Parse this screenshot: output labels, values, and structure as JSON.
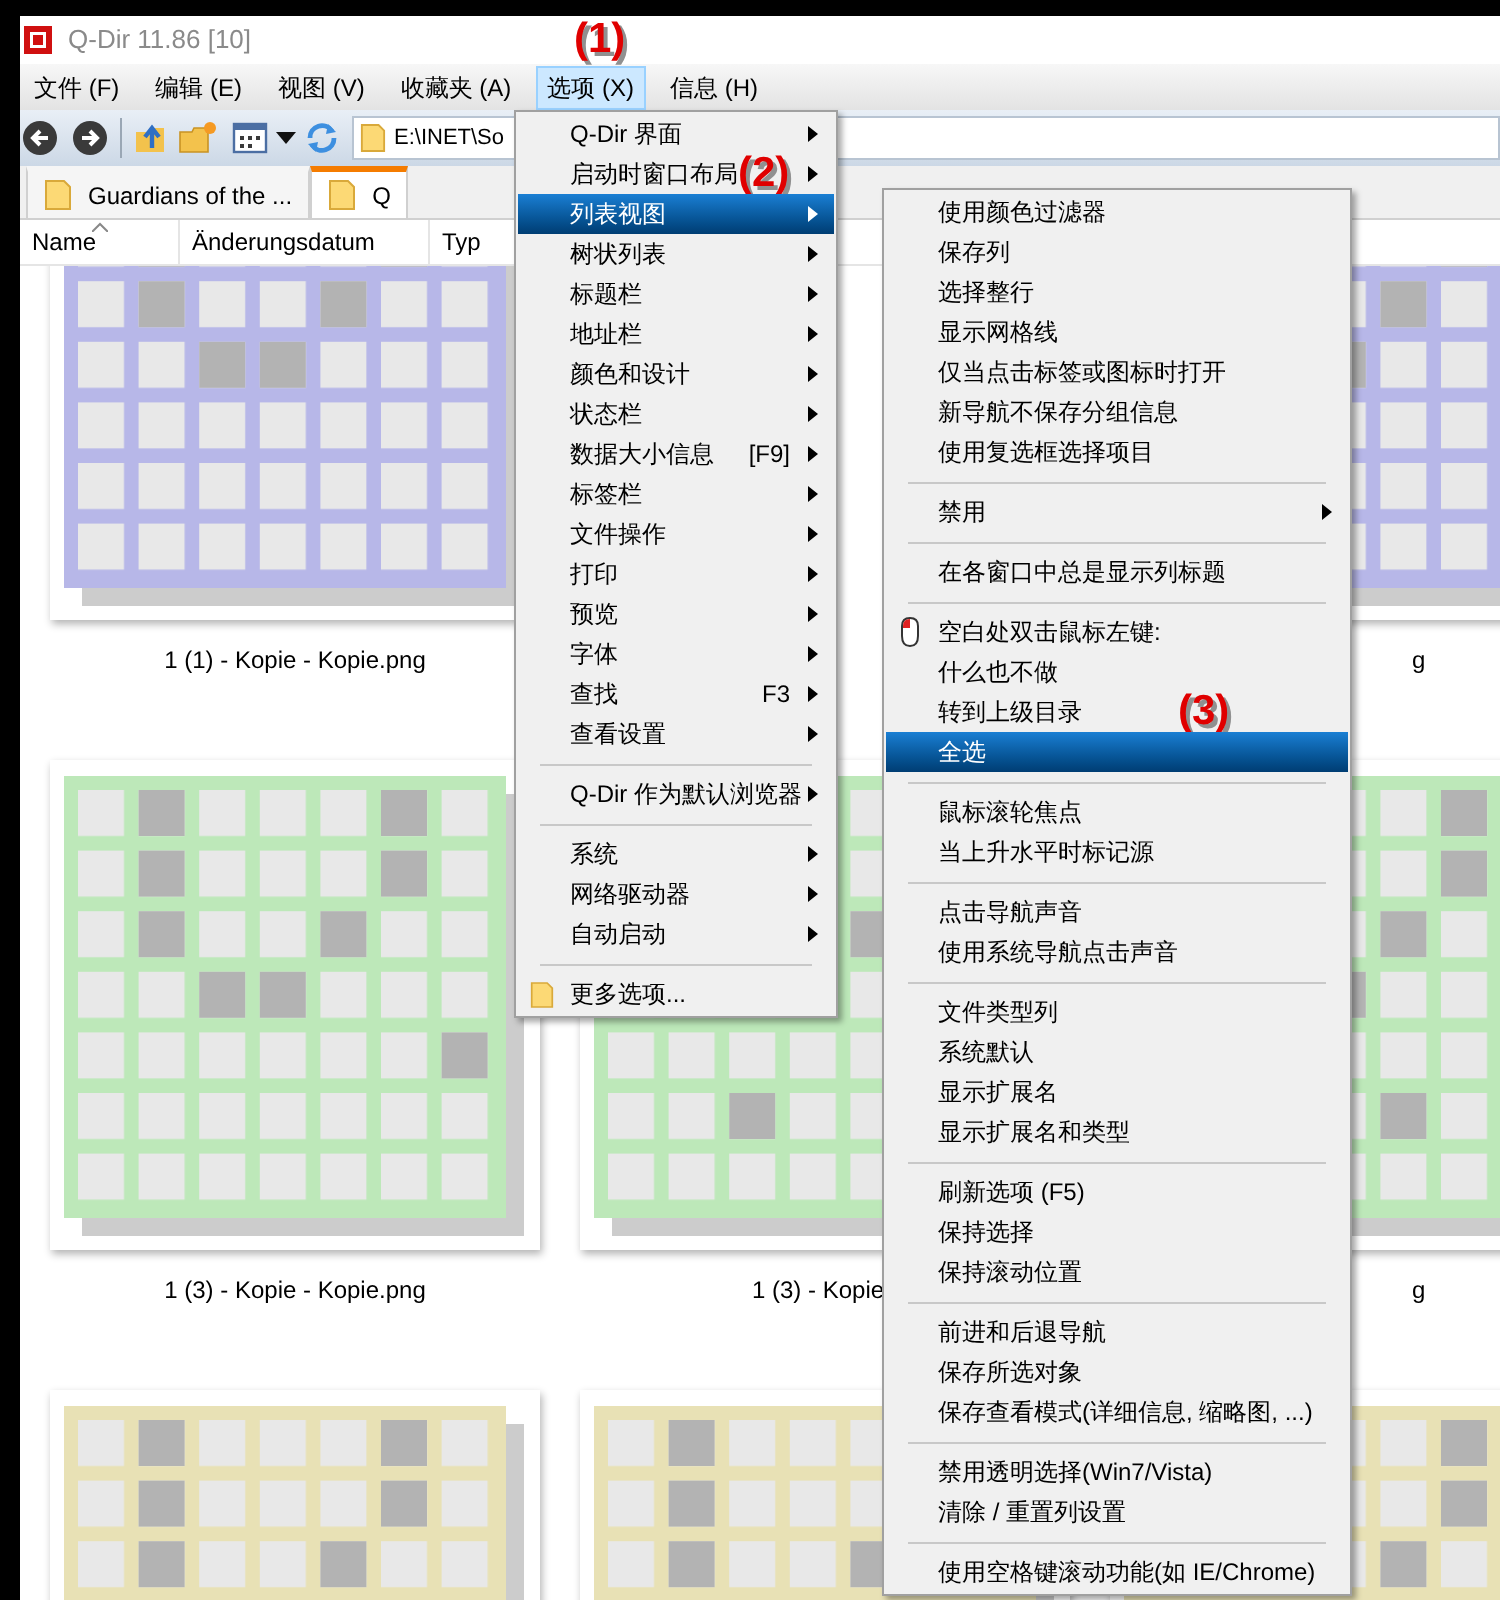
{
  "window": {
    "title": "Q-Dir 11.86 [10]"
  },
  "menubar": [
    {
      "label": "文件 (F)",
      "selected": false
    },
    {
      "label": "编辑 (E)",
      "selected": false
    },
    {
      "label": "视图 (V)",
      "selected": false
    },
    {
      "label": "收藏夹 (A)",
      "selected": false
    },
    {
      "label": "选项 (X)",
      "selected": true
    },
    {
      "label": "信息 (H)",
      "selected": false
    }
  ],
  "toolbar": {
    "address": "E:\\INET\\So"
  },
  "tabs": [
    {
      "label": "Guardians of the ...",
      "selected": false
    },
    {
      "label": "Q",
      "selected": true
    }
  ],
  "columns": [
    {
      "label": "Name",
      "sorted": true
    },
    {
      "label": "Änderungsdatum",
      "sorted": false
    },
    {
      "label": "Typ",
      "sorted": false
    }
  ],
  "thumbnail_rows": [
    {
      "cells": [
        {
          "kind": "picture",
          "caption": "1 (1) - Kopie - Kopie.png"
        },
        {
          "kind": "blank"
        },
        {
          "kind": "picture",
          "caption": "g"
        }
      ]
    },
    {
      "cells": [
        {
          "kind": "picture",
          "caption": "1 (3) - Kopie - Kopie.png"
        },
        {
          "kind": "picture",
          "caption": "1 (3) - Kopie"
        },
        {
          "kind": "picture",
          "caption": "g"
        }
      ]
    },
    {
      "cells": [
        {
          "kind": "picture"
        },
        {
          "kind": "picture"
        },
        {
          "kind": "picture"
        }
      ]
    }
  ],
  "options_menu": {
    "items": [
      {
        "kind": "item",
        "label": "Q-Dir 界面",
        "submenu": true,
        "selected": false
      },
      {
        "kind": "item",
        "label": "启动时窗口布局",
        "submenu": true,
        "selected": false
      },
      {
        "kind": "item",
        "label": "列表视图",
        "submenu": true,
        "selected": true
      },
      {
        "kind": "item",
        "label": "树状列表",
        "submenu": true,
        "selected": false
      },
      {
        "kind": "item",
        "label": "标题栏",
        "submenu": true,
        "selected": false
      },
      {
        "kind": "item",
        "label": "地址栏",
        "submenu": true,
        "selected": false
      },
      {
        "kind": "item",
        "label": "颜色和设计",
        "submenu": true,
        "selected": false
      },
      {
        "kind": "item",
        "label": "状态栏",
        "submenu": true,
        "selected": false
      },
      {
        "kind": "item",
        "label": "数据大小信息",
        "shortcut": "[F9]",
        "submenu": true,
        "selected": false
      },
      {
        "kind": "item",
        "label": "标签栏",
        "submenu": true,
        "selected": false
      },
      {
        "kind": "item",
        "label": "文件操作",
        "submenu": true,
        "selected": false
      },
      {
        "kind": "item",
        "label": "打印",
        "submenu": true,
        "selected": false
      },
      {
        "kind": "item",
        "label": "预览",
        "submenu": true,
        "selected": false
      },
      {
        "kind": "item",
        "label": "字体",
        "submenu": true,
        "selected": false
      },
      {
        "kind": "item",
        "label": "查找",
        "shortcut": "F3",
        "submenu": true,
        "selected": false
      },
      {
        "kind": "item",
        "label": "查看设置",
        "submenu": true,
        "selected": false
      },
      {
        "kind": "separator"
      },
      {
        "kind": "item",
        "label": "Q-Dir 作为默认浏览器",
        "submenu": true,
        "selected": false
      },
      {
        "kind": "separator"
      },
      {
        "kind": "item",
        "label": "系统",
        "submenu": true,
        "selected": false
      },
      {
        "kind": "item",
        "label": "网络驱动器",
        "submenu": true,
        "selected": false
      },
      {
        "kind": "item",
        "label": "自动启动",
        "submenu": true,
        "selected": false
      },
      {
        "kind": "separator"
      },
      {
        "kind": "folder_item",
        "label": "更多选项...",
        "submenu": false,
        "selected": false
      }
    ]
  },
  "list_view_submenu": {
    "items": [
      {
        "kind": "item",
        "label": "使用颜色过滤器",
        "submenu": false,
        "selected": false
      },
      {
        "kind": "item",
        "label": "保存列",
        "submenu": false,
        "selected": false
      },
      {
        "kind": "item",
        "label": "选择整行",
        "submenu": false,
        "selected": false
      },
      {
        "kind": "item",
        "label": "显示网格线",
        "submenu": false,
        "selected": false
      },
      {
        "kind": "item",
        "label": "仅当点击标签或图标时打开",
        "submenu": false,
        "selected": false
      },
      {
        "kind": "item",
        "label": "新导航不保存分组信息",
        "submenu": false,
        "selected": false
      },
      {
        "kind": "item",
        "label": "使用复选框选择项目",
        "submenu": false,
        "selected": false
      },
      {
        "kind": "separator"
      },
      {
        "kind": "item",
        "label": "禁用",
        "submenu": true,
        "selected": false
      },
      {
        "kind": "separator"
      },
      {
        "kind": "item",
        "label": "在各窗口中总是显示列标题",
        "submenu": false,
        "selected": false
      },
      {
        "kind": "separator"
      },
      {
        "kind": "mouse_item",
        "label": "空白处双击鼠标左键:",
        "submenu": false,
        "selected": false
      },
      {
        "kind": "item",
        "label": "什么也不做",
        "submenu": false,
        "selected": false
      },
      {
        "kind": "item",
        "label": "转到上级目录",
        "submenu": false,
        "selected": false
      },
      {
        "kind": "item",
        "label": "全选",
        "submenu": false,
        "selected": true
      },
      {
        "kind": "separator"
      },
      {
        "kind": "item",
        "label": "鼠标滚轮焦点",
        "submenu": false,
        "selected": false
      },
      {
        "kind": "item",
        "label": "当上升水平时标记源",
        "submenu": false,
        "selected": false
      },
      {
        "kind": "separator"
      },
      {
        "kind": "item",
        "label": "点击导航声音",
        "submenu": false,
        "selected": false
      },
      {
        "kind": "item",
        "label": "使用系统导航点击声音",
        "submenu": false,
        "selected": false
      },
      {
        "kind": "separator"
      },
      {
        "kind": "item",
        "label": "文件类型列",
        "submenu": false,
        "selected": false
      },
      {
        "kind": "item",
        "label": "系统默认",
        "submenu": false,
        "selected": false
      },
      {
        "kind": "item",
        "label": "显示扩展名",
        "submenu": false,
        "selected": false
      },
      {
        "kind": "item",
        "label": "显示扩展名和类型",
        "submenu": false,
        "selected": false
      },
      {
        "kind": "separator"
      },
      {
        "kind": "item",
        "label": "刷新选项 (F5)",
        "submenu": false,
        "selected": false
      },
      {
        "kind": "item",
        "label": "保持选择",
        "submenu": false,
        "selected": false
      },
      {
        "kind": "item",
        "label": "保持滚动位置",
        "submenu": false,
        "selected": false
      },
      {
        "kind": "separator"
      },
      {
        "kind": "item",
        "label": "前进和后退导航",
        "submenu": false,
        "selected": false
      },
      {
        "kind": "item",
        "label": "保存所选对象",
        "submenu": false,
        "selected": false
      },
      {
        "kind": "item",
        "label": "保存查看模式(详细信息, 缩略图, ...)",
        "submenu": false,
        "selected": false
      },
      {
        "kind": "separator"
      },
      {
        "kind": "item",
        "label": "禁用透明选择(Win7/Vista)",
        "submenu": false,
        "selected": false
      },
      {
        "kind": "item",
        "label": "清除 / 重置列设置",
        "submenu": false,
        "selected": false
      },
      {
        "kind": "separator"
      },
      {
        "kind": "item",
        "label": "使用空格键滚动功能(如 IE/Chrome)",
        "submenu": false,
        "selected": false
      }
    ]
  },
  "annotations": [
    {
      "label": "(1)"
    },
    {
      "label": "(2)"
    },
    {
      "label": "(3)"
    }
  ]
}
